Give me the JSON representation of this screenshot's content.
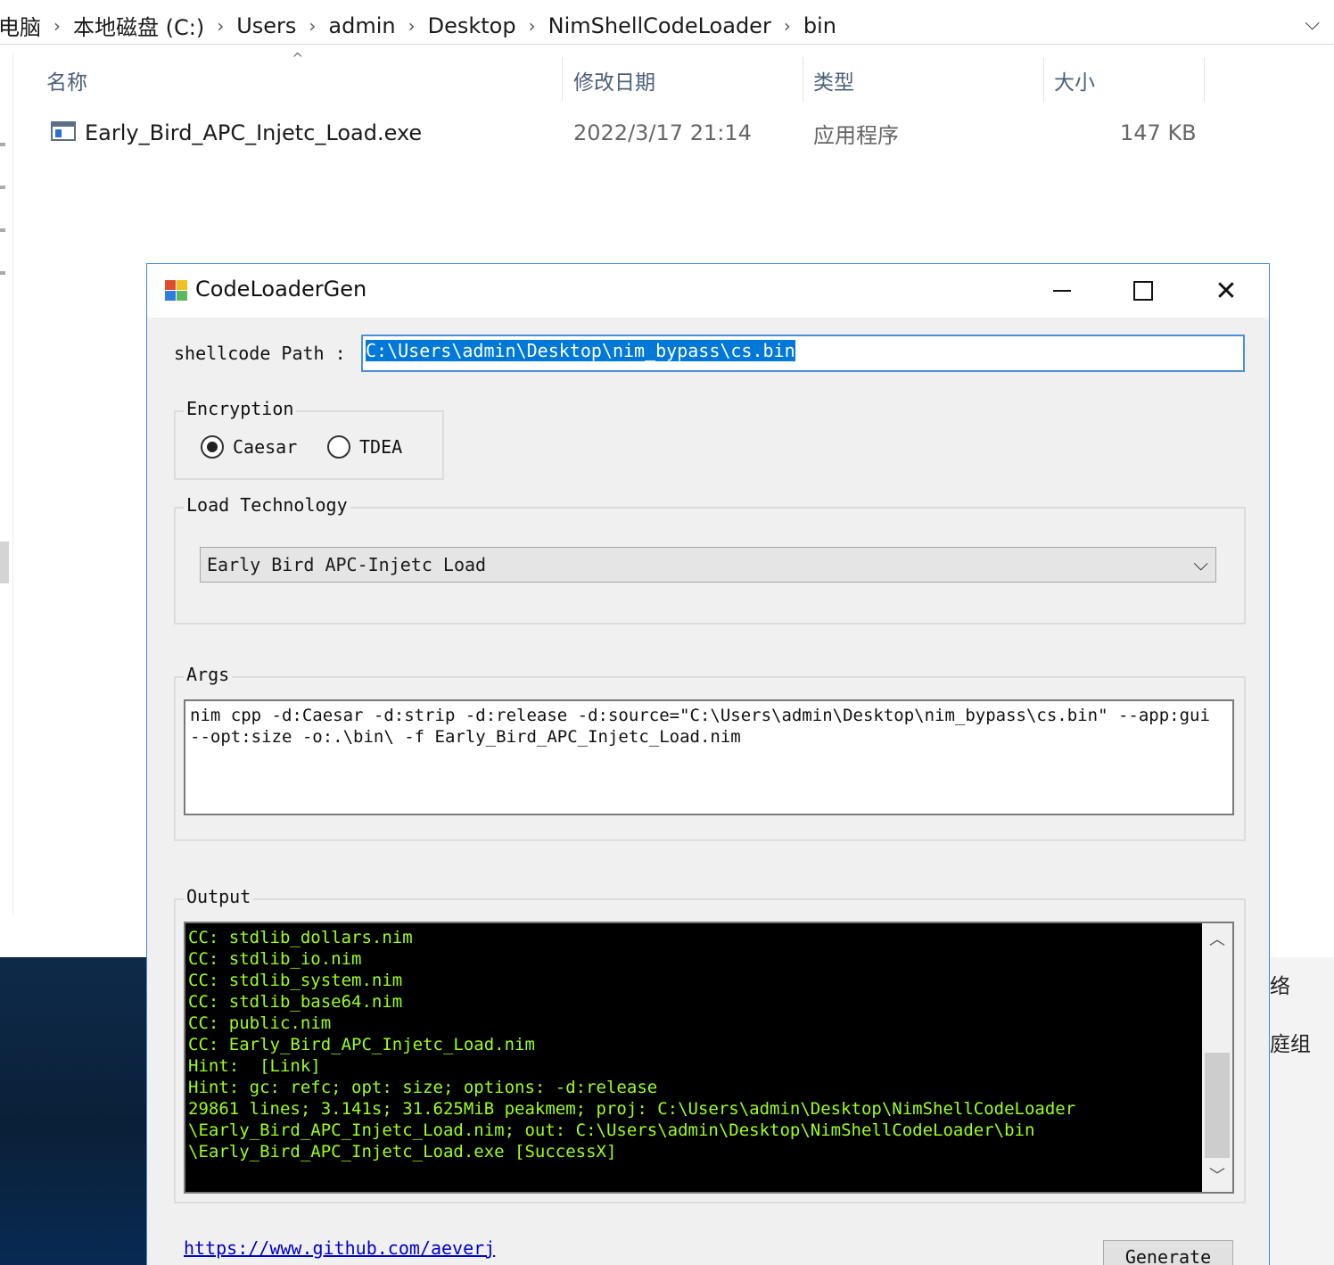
{
  "explorer": {
    "breadcrumb": [
      "电脑",
      "本地磁盘 (C:)",
      "Users",
      "admin",
      "Desktop",
      "NimShellCodeLoader",
      "bin"
    ],
    "columns": {
      "name": "名称",
      "modified": "修改日期",
      "type": "类型",
      "size": "大小"
    },
    "files": [
      {
        "name": "Early_Bird_APC_Injetc_Load.exe",
        "modified": "2022/3/17 21:14",
        "type": "应用程序",
        "size": "147 KB"
      }
    ],
    "right_strip": [
      "络",
      "庭组"
    ]
  },
  "dialog": {
    "title": "CodeLoaderGen",
    "shellcode_label": "shellcode Path :",
    "shellcode_path": "C:\\Users\\admin\\Desktop\\nim_bypass\\cs.bin",
    "encryption": {
      "title": "Encryption",
      "options": [
        "Caesar",
        "TDEA"
      ],
      "selected": "Caesar"
    },
    "load_technology": {
      "title": "Load Technology",
      "selected": "Early Bird APC-Injetc Load"
    },
    "args": {
      "title": "Args",
      "value": "nim cpp -d:Caesar -d:strip -d:release -d:source=\"C:\\Users\\admin\\Desktop\\nim_bypass\\cs.bin\" --app:gui --opt:size -o:.\\bin\\ -f Early_Bird_APC_Injetc_Load.nim"
    },
    "output": {
      "title": "Output",
      "lines": [
        "CC: stdlib_dollars.nim",
        "CC: stdlib_io.nim",
        "CC: stdlib_system.nim",
        "CC: stdlib_base64.nim",
        "CC: public.nim",
        "CC: Early_Bird_APC_Injetc_Load.nim",
        "Hint:  [Link]",
        "Hint: gc: refc; opt: size; options: -d:release",
        "29861 lines; 3.141s; 31.625MiB peakmem; proj: C:\\Users\\admin\\Desktop\\NimShellCodeLoader",
        "\\Early_Bird_APC_Injetc_Load.nim; out: C:\\Users\\admin\\Desktop\\NimShellCodeLoader\\bin",
        "\\Early_Bird_APC_Injetc_Load.exe [SuccessX]"
      ]
    },
    "link": "https://www.github.com/aeverj",
    "generate_label": "Generate"
  },
  "colors": {
    "accent": "#0078d7",
    "console_bg": "#000000",
    "console_text": "#9cff1c",
    "link": "#0000cc"
  }
}
